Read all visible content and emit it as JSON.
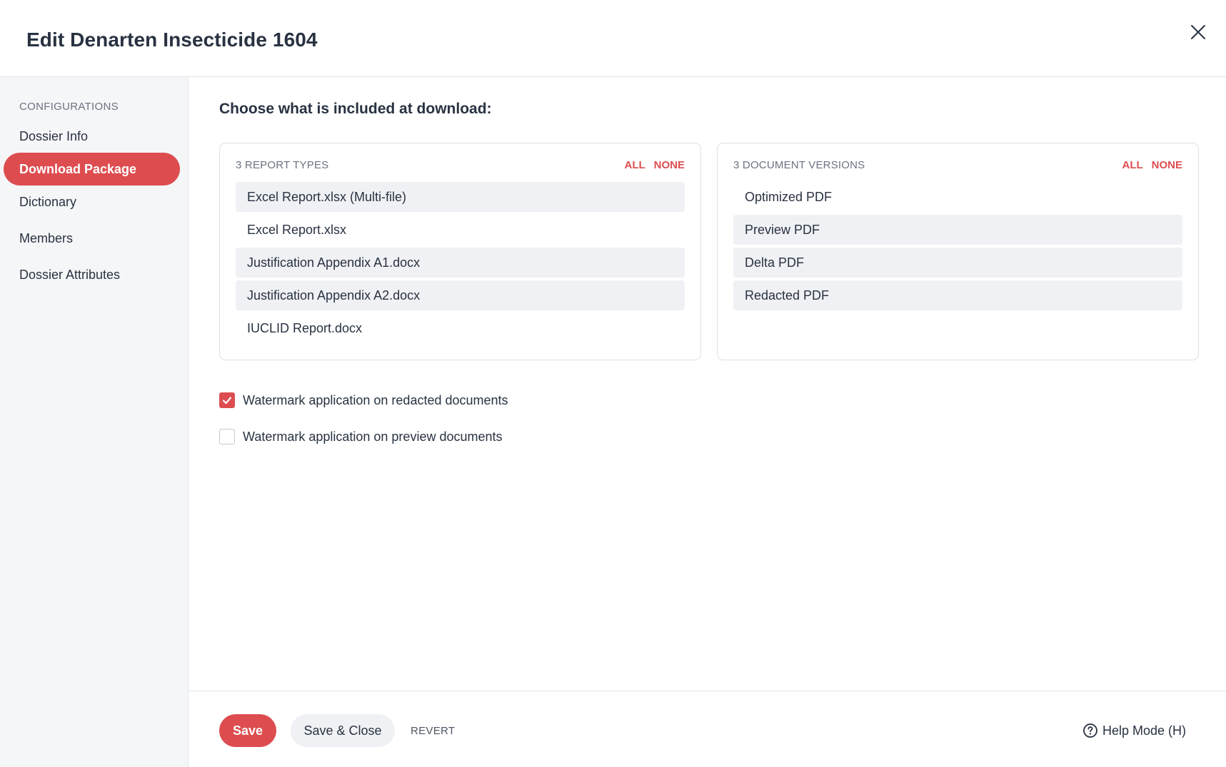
{
  "header": {
    "title": "Edit Denarten Insecticide 1604",
    "close_icon": "close-icon"
  },
  "sidebar": {
    "heading": "CONFIGURATIONS",
    "active_index": 1,
    "items": [
      {
        "label": "Dossier Info"
      },
      {
        "label": "Download Package"
      },
      {
        "label": "Dictionary"
      },
      {
        "label": "Members"
      },
      {
        "label": "Dossier Attributes"
      }
    ]
  },
  "main": {
    "section_title": "Choose what is included at download:",
    "report_types": {
      "heading": "3 REPORT TYPES",
      "all_label": "ALL",
      "none_label": "NONE",
      "items": [
        {
          "label": "Excel Report.xlsx (Multi-file)",
          "selected": true
        },
        {
          "label": "Excel Report.xlsx",
          "selected": false
        },
        {
          "label": "Justification Appendix A1.docx",
          "selected": true
        },
        {
          "label": "Justification Appendix A2.docx",
          "selected": true
        },
        {
          "label": "IUCLID Report.docx",
          "selected": false
        }
      ]
    },
    "document_versions": {
      "heading": "3 DOCUMENT VERSIONS",
      "all_label": "ALL",
      "none_label": "NONE",
      "items": [
        {
          "label": "Optimized PDF",
          "selected": false
        },
        {
          "label": "Preview PDF",
          "selected": true
        },
        {
          "label": "Delta PDF",
          "selected": true
        },
        {
          "label": "Redacted PDF",
          "selected": true
        }
      ]
    },
    "watermark_redacted": {
      "label": "Watermark application on redacted documents",
      "checked": true
    },
    "watermark_preview": {
      "label": "Watermark application on preview documents",
      "checked": false
    }
  },
  "footer": {
    "save_label": "Save",
    "save_close_label": "Save & Close",
    "revert_label": "REVERT",
    "help_label": "Help Mode (H)",
    "help_icon": "help-circle-icon"
  },
  "colors": {
    "accent": "#dd4d50",
    "text": "#283241",
    "selected_row": "#f0f1f4",
    "sidebar_bg": "#f5f6f8"
  }
}
